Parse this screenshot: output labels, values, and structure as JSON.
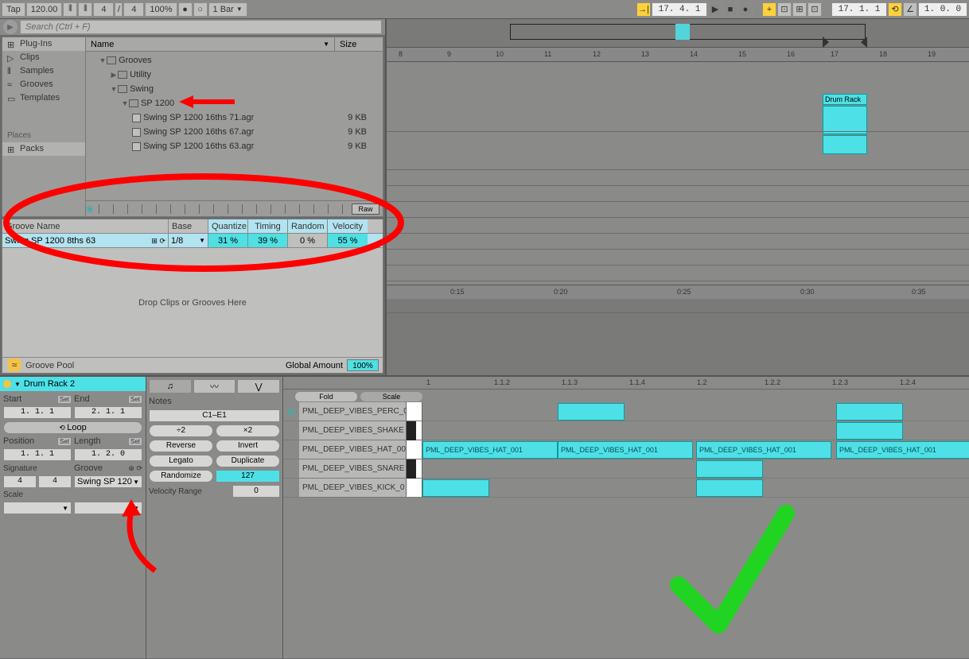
{
  "top": {
    "tap": "Tap",
    "bpm": "120.00",
    "sig1": "4",
    "sig2": "4",
    "pct": "100%",
    "bar": "1 Bar",
    "pos": "17. 4. 1",
    "pos2": "17. 1. 1",
    "end": "1. 0. 0"
  },
  "search": {
    "placeholder": "Search (Ctrl + F)"
  },
  "categories": [
    "Plug-Ins",
    "Clips",
    "Samples",
    "Grooves",
    "Templates"
  ],
  "places_hdr": "Places",
  "places": [
    "Packs"
  ],
  "file_cols": {
    "name": "Name",
    "size": "Size"
  },
  "tree": {
    "grooves": "Grooves",
    "utility": "Utility",
    "swing": "Swing",
    "sp1200": "SP 1200",
    "files": [
      {
        "n": "Swing SP 1200 16ths 71.agr",
        "s": "9 KB"
      },
      {
        "n": "Swing SP 1200 16ths 67.agr",
        "s": "9 KB"
      },
      {
        "n": "Swing SP 1200 16ths 63.agr",
        "s": "9 KB"
      }
    ]
  },
  "raw": "Raw",
  "groove_pool": {
    "hdr": [
      "Groove Name",
      "Base",
      "Quantize",
      "Timing",
      "Random",
      "Velocity"
    ],
    "row": {
      "name": "Swing SP 1200 8ths 63",
      "base": "1/8",
      "q": "31 %",
      "t": "39 %",
      "r": "0 %",
      "v": "55 %"
    },
    "drop": "Drop Clips or Grooves Here",
    "foot": "Groove Pool",
    "global": "Global Amount",
    "amount": "100%"
  },
  "ruler_bars": [
    "8",
    "9",
    "10",
    "11",
    "12",
    "13",
    "14",
    "15",
    "16",
    "17",
    "18",
    "19"
  ],
  "clip_label": "Drum Rack",
  "time_ruler": [
    "0:15",
    "0:20",
    "0:25",
    "0:30",
    "0:35"
  ],
  "clip": {
    "title": "Drum Rack 2",
    "start_l": "Start",
    "end_l": "End",
    "start": "1. 1. 1",
    "end": "2. 1. 1",
    "loop": "Loop",
    "pos_l": "Position",
    "len_l": "Length",
    "pos": "1. 1. 1",
    "len": "1. 2. 0",
    "sig_l": "Signature",
    "groove_l": "Groove",
    "sig1": "4",
    "sig2": "4",
    "groove": "Swing SP 120",
    "scale_l": "Scale"
  },
  "notes": {
    "tab": "Notes",
    "range": "C1–E1",
    "btns1": [
      "÷2",
      "×2"
    ],
    "btns2": [
      "Reverse",
      "Invert"
    ],
    "btns3": [
      "Legato",
      "Duplicate"
    ],
    "rand": "Randomize",
    "rand_v": "127",
    "vel": "Velocity Range",
    "vel_v": "0"
  },
  "pv": {
    "fold": "Fold",
    "scale": "Scale",
    "ruler": [
      "1",
      "1.1.2",
      "1.1.3",
      "1.1.4",
      "1.2",
      "1.2.2",
      "1.2.3",
      "1.2.4"
    ],
    "rows": [
      {
        "label": "PML_DEEP_VIBES_PERC_0"
      },
      {
        "label": "PML_DEEP_VIBES_SHAKE"
      },
      {
        "label": "PML_DEEP_VIBES_HAT_00"
      },
      {
        "label": "PML_DEEP_VIBES_SNARE"
      },
      {
        "label": "PML_DEEP_VIBES_KICK_0"
      }
    ],
    "hat_note": "PML_DEEP_VIBES_HAT_001"
  }
}
